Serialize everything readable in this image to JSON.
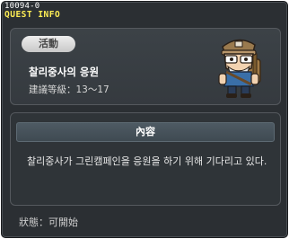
{
  "window": {
    "quest_id": "10094-0",
    "title": "QUEST INFO"
  },
  "quest": {
    "category": "活動",
    "name": "찰리중사의 응원",
    "level_range": "建議等級：13～17"
  },
  "content": {
    "header": "內容",
    "text": "찰리중사가 그린캠페인을 응원을 하기 위해 기다리고 있다."
  },
  "status": {
    "text": "狀態：可開始"
  },
  "npc": {
    "icon": "sergeant-charlie-npc-icon"
  }
}
